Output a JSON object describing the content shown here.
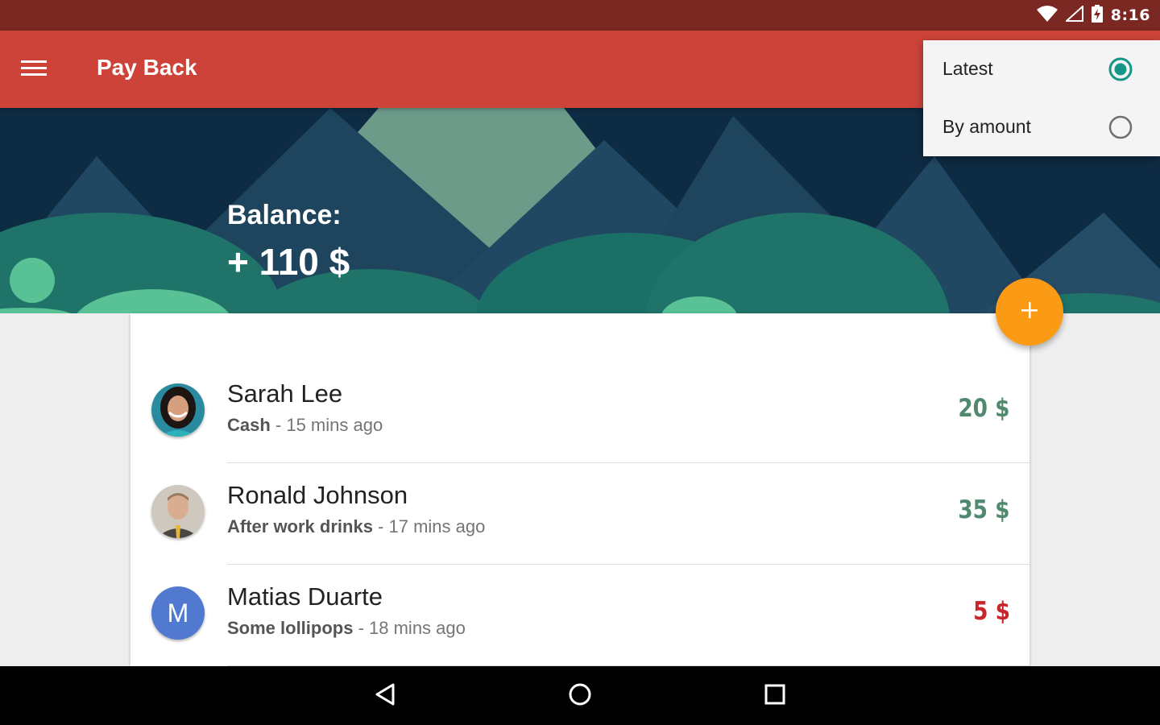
{
  "status_bar": {
    "time": "8:16"
  },
  "app_bar": {
    "title": "Pay Back"
  },
  "hero": {
    "balance_label": "Balance:",
    "balance_value": "+ 110 $"
  },
  "sort_menu": {
    "items": [
      {
        "label": "Latest",
        "selected": true
      },
      {
        "label": "By amount",
        "selected": false
      }
    ]
  },
  "transactions": [
    {
      "name": "Sarah Lee",
      "method": "Cash",
      "time": " - 15 mins ago",
      "amount": "20 $",
      "amount_color": "#4f8a6f"
    },
    {
      "name": "Ronald Johnson",
      "method": "After work drinks",
      "time": " - 17 mins ago",
      "amount": "35 $",
      "amount_color": "#4f8a6f"
    },
    {
      "name": "Matias Duarte",
      "initial": "M",
      "method": "Some lollipops",
      "time": " - 18 mins ago",
      "amount": "5 $",
      "amount_color": "#c8252c"
    }
  ],
  "colors": {
    "status_bar": "#7b2722",
    "app_bar": "#cd4339",
    "accent": "#fb9b15",
    "radio_selected": "#149688",
    "avatar_m": "#5079cf"
  },
  "icons": {
    "menu": "hamburger-icon",
    "add": "plus-icon",
    "back": "triangle-back-icon",
    "home": "circle-home-icon",
    "recents": "square-recents-icon"
  }
}
